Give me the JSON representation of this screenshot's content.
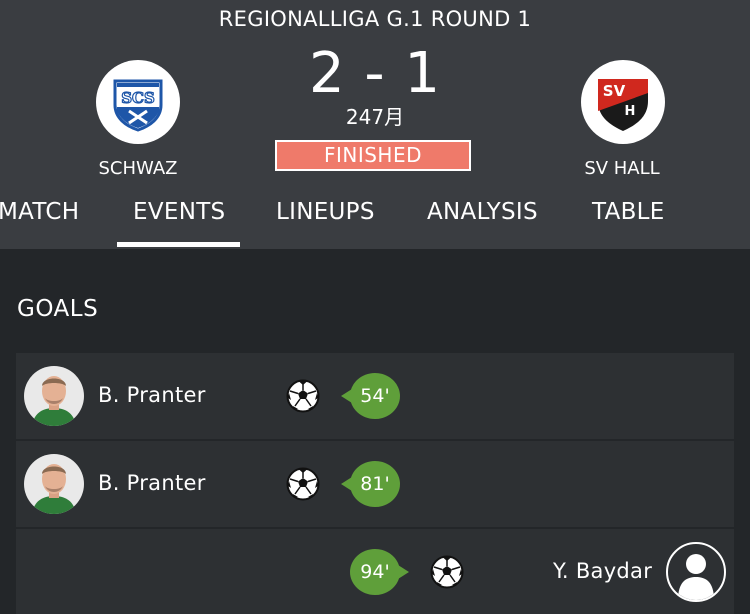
{
  "match": {
    "competition": "REGIONALLIGA G.1 ROUND 1",
    "score": "2 - 1",
    "attendance": "247月",
    "status": "FINISHED",
    "status_color": "#ef7a6a"
  },
  "home_team": {
    "name": "SCHWAZ",
    "crest_icon": "scs-crest-icon",
    "color": "#1e56a8"
  },
  "away_team": {
    "name": "SV HALL",
    "crest_icon": "sv-hall-crest-icon",
    "color": "#d0281e"
  },
  "tabs": [
    {
      "label": "MATCH"
    },
    {
      "label": "EVENTS",
      "active": true
    },
    {
      "label": "LINEUPS"
    },
    {
      "label": "ANALYSIS"
    },
    {
      "label": "TABLE"
    }
  ],
  "goals": {
    "title": "GOALS",
    "events": [
      {
        "player": "B. Pranter",
        "minute": "54'",
        "side": "home",
        "icon": "soccer-ball-icon"
      },
      {
        "player": "B. Pranter",
        "minute": "81'",
        "side": "home",
        "icon": "soccer-ball-icon"
      },
      {
        "player": "Y. Baydar",
        "minute": "94'",
        "side": "away",
        "icon": "soccer-ball-icon"
      }
    ]
  },
  "colors": {
    "minute_badge": "#5f9f3a",
    "header_bg": "#3a3d41",
    "body_bg": "#232629"
  }
}
